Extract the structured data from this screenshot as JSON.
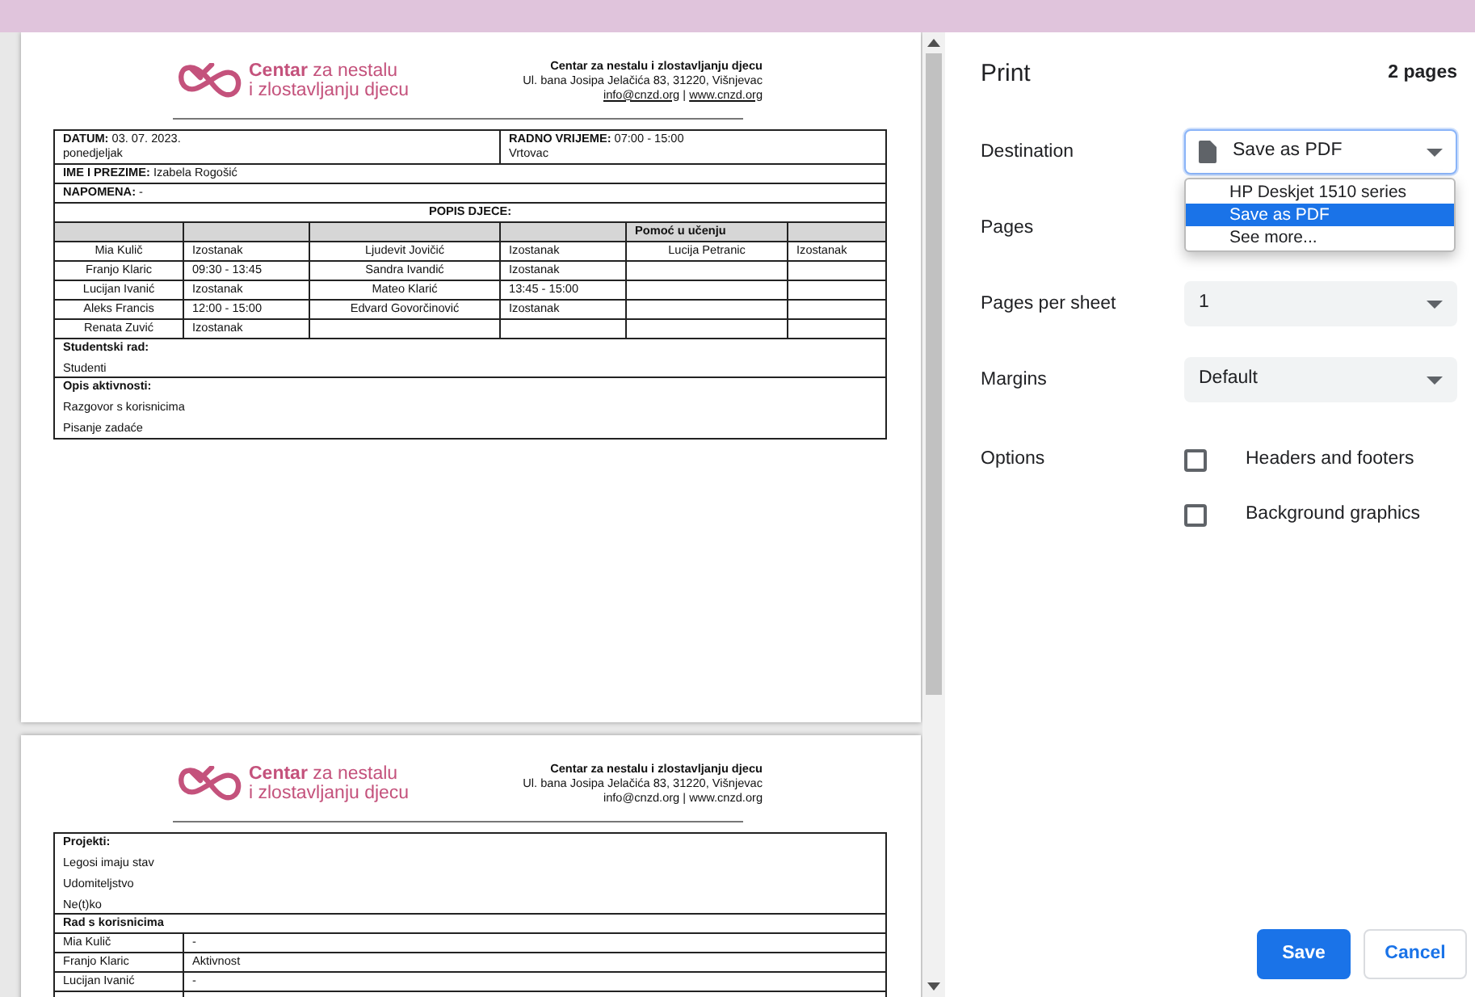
{
  "preview": {
    "pages": [
      {
        "header": {
          "logo_bold": "Centar",
          "logo_rest": "za nestalu",
          "logo_line2": "i zlostavljanju djecu",
          "org_name": "Centar za nestalu i zlostavljanju djecu",
          "address": "Ul. bana Josipa Jelačića 83, 31220, Višnjevac",
          "email": "info@cnzd.org",
          "separator": "|",
          "web": "www.cnzd.org",
          "links_underlined": true
        },
        "kind": "report",
        "info": {
          "date_label": "DATUM:",
          "date": "03. 07. 2023.",
          "day": "ponedjeljak",
          "hours_label": "RADNO VRIJEME:",
          "hours": "07:00 - 15:00",
          "place": "Vrtovac",
          "name_label": "IME I PREZIME:",
          "name": "Izabela Rogošić",
          "note_label": "NAPOMENA:",
          "note": "-"
        },
        "children_title": "POPIS DJECE:",
        "column_5_heading": "Pomoć u učenju",
        "children_rows": [
          {
            "cells": [
              "Mia Kulič",
              "Izostanak",
              "Ljudevit Jovičić",
              "Izostanak",
              "Lucija Petranic",
              "Izostanak"
            ]
          },
          {
            "cells": [
              "Franjo Klaric",
              "09:30 - 13:45",
              "Sandra Ivandić",
              "Izostanak"
            ]
          },
          {
            "cells": [
              "Lucijan Ivanić",
              "Izostanak",
              "Mateo Klarić",
              "13:45 - 15:00"
            ]
          },
          {
            "cells": [
              "Aleks Francis",
              "12:00 - 15:00",
              "Edvard Govorčinović",
              "Izostanak"
            ]
          },
          {
            "cells": [
              "Renata Zuvić",
              "Izostanak"
            ]
          }
        ],
        "sections": [
          {
            "title": "Studentski rad:",
            "lines": [
              "Studenti"
            ]
          },
          {
            "title": "Opis aktivnosti:",
            "lines": [
              "Razgovor s korisnicima",
              "Pisanje zadaće"
            ]
          }
        ]
      },
      {
        "header": {
          "logo_bold": "Centar",
          "logo_rest": "za nestalu",
          "logo_line2": "i zlostavljanju djecu",
          "org_name": "Centar za nestalu i zlostavljanju djecu",
          "address": "Ul. bana Josipa Jelačića 83, 31220, Višnjevac",
          "email": "info@cnzd.org",
          "separator": "|",
          "web": "www.cnzd.org",
          "links_underlined": false
        },
        "kind": "continuation",
        "sections": [
          {
            "title": "Projekti:",
            "lines": [
              "Legosi imaju stav",
              "Udomiteljstvo",
              "Ne(t)ko"
            ]
          }
        ],
        "users_title": "Rad s korisnicima",
        "user_rows": [
          {
            "name": "Mia Kulič",
            "value": "-"
          },
          {
            "name": "Franjo Klaric",
            "value": "Aktivnost"
          },
          {
            "name": "Lucijan Ivanić",
            "value": "-"
          }
        ]
      }
    ]
  },
  "print_panel": {
    "title": "Print",
    "page_count": "2 pages",
    "settings": [
      {
        "label": "Destination",
        "kind": "select",
        "value": "Save as PDF",
        "expanded": true,
        "options": [
          {
            "label": "HP Deskjet 1510 series",
            "selected": false
          },
          {
            "label": "Save as PDF",
            "selected": true
          },
          {
            "label": "See more...",
            "selected": false
          }
        ]
      },
      {
        "label": "Pages",
        "kind": "covered"
      },
      {
        "label": "Pages per sheet",
        "kind": "select",
        "value": "1",
        "expanded": false
      },
      {
        "label": "Margins",
        "kind": "select",
        "value": "Default",
        "expanded": false
      },
      {
        "label": "Options",
        "kind": "checkboxes",
        "options": [
          {
            "label": "Headers and footers",
            "checked": false
          },
          {
            "label": "Background graphics",
            "checked": false
          }
        ]
      }
    ],
    "buttons": [
      {
        "label": "Save",
        "kind": "primary"
      },
      {
        "label": "Cancel",
        "kind": "secondary"
      }
    ]
  }
}
